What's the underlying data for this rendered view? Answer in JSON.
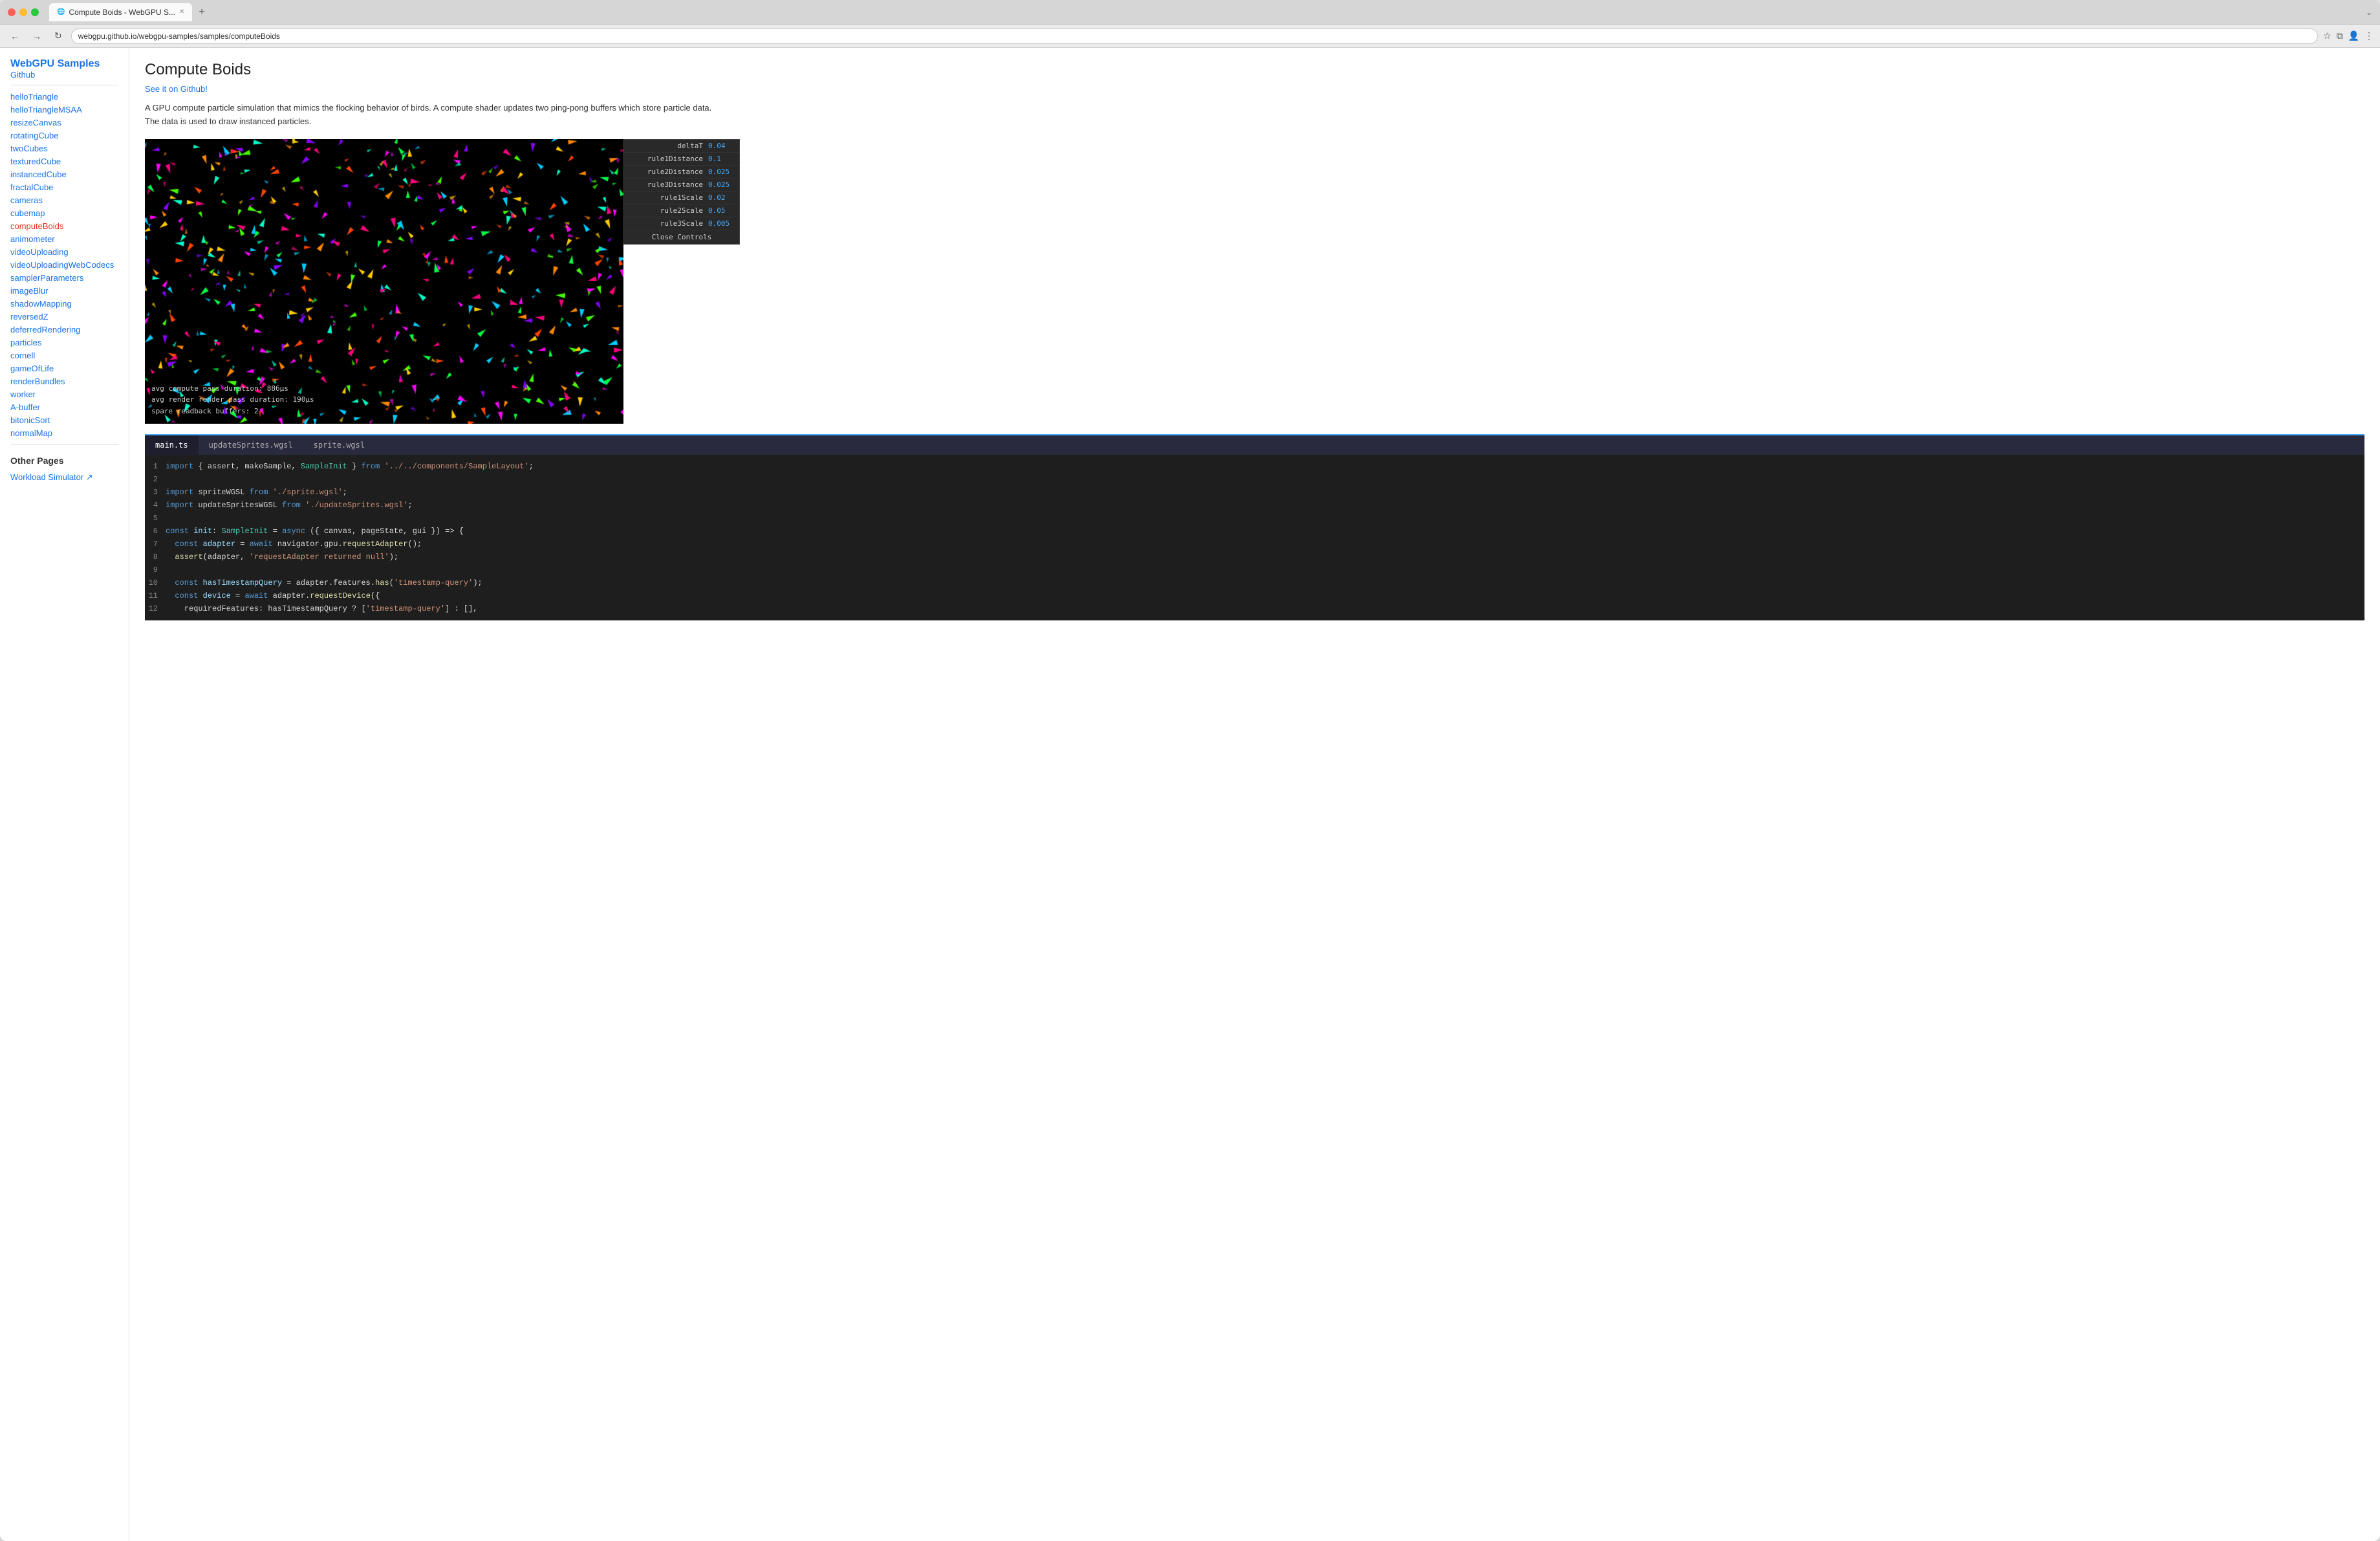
{
  "browser": {
    "tab_title": "Compute Boids - WebGPU S...",
    "url": "webgpu.github.io/webgpu-samples/samples/computeBoids",
    "new_tab_label": "+",
    "nav": {
      "back": "←",
      "forward": "→",
      "reload": "↻"
    }
  },
  "sidebar": {
    "title": "WebGPU Samples",
    "github_link": "Github",
    "nav_items": [
      {
        "label": "helloTriangle",
        "active": false
      },
      {
        "label": "helloTriangleMSAA",
        "active": false
      },
      {
        "label": "resizeCanvas",
        "active": false
      },
      {
        "label": "rotatingCube",
        "active": false
      },
      {
        "label": "twoCubes",
        "active": false
      },
      {
        "label": "texturedCube",
        "active": false
      },
      {
        "label": "instancedCube",
        "active": false
      },
      {
        "label": "fractalCube",
        "active": false
      },
      {
        "label": "cameras",
        "active": false
      },
      {
        "label": "cubemap",
        "active": false
      },
      {
        "label": "computeBoids",
        "active": true
      },
      {
        "label": "animometer",
        "active": false
      },
      {
        "label": "videoUploading",
        "active": false
      },
      {
        "label": "videoUploadingWebCodecs",
        "active": false
      },
      {
        "label": "samplerParameters",
        "active": false
      },
      {
        "label": "imageBlur",
        "active": false
      },
      {
        "label": "shadowMapping",
        "active": false
      },
      {
        "label": "reversedZ",
        "active": false
      },
      {
        "label": "deferredRendering",
        "active": false
      },
      {
        "label": "particles",
        "active": false
      },
      {
        "label": "cornell",
        "active": false
      },
      {
        "label": "gameOfLife",
        "active": false
      },
      {
        "label": "renderBundles",
        "active": false
      },
      {
        "label": "worker",
        "active": false
      },
      {
        "label": "A-buffer",
        "active": false
      },
      {
        "label": "bitonicSort",
        "active": false
      },
      {
        "label": "normalMap",
        "active": false
      }
    ],
    "other_pages_title": "Other Pages",
    "other_pages": [
      {
        "label": "Workload Simulator ↗"
      }
    ]
  },
  "main": {
    "title": "Compute Boids",
    "github_link": "See it on Github!",
    "description": "A GPU compute particle simulation that mimics the flocking behavior of birds. A compute shader updates two ping-pong buffers which store particle data. The data is used to draw instanced particles.",
    "stats": {
      "compute_pass": "avg compute pass duration:  886µs",
      "render_pass": "avg render render pass duration:  190µs",
      "spare_readback": "spare readback buffers:    2"
    },
    "controls": {
      "items": [
        {
          "label": "deltaT",
          "value": "0.04"
        },
        {
          "label": "rule1Distance",
          "value": "0.1"
        },
        {
          "label": "rule2Distance",
          "value": "0.025"
        },
        {
          "label": "rule3Distance",
          "value": "0.025"
        },
        {
          "label": "rule1Scale",
          "value": "0.02"
        },
        {
          "label": "rule2Scale",
          "value": "0.05"
        },
        {
          "label": "rule3Scale",
          "value": "0.005"
        }
      ],
      "close_label": "Close Controls"
    },
    "tabs": [
      {
        "label": "main.ts",
        "active": true
      },
      {
        "label": "updateSprites.wgsl",
        "active": false
      },
      {
        "label": "sprite.wgsl",
        "active": false
      }
    ],
    "code_lines": [
      {
        "num": 1,
        "content": "import { assert, makeSample, SampleInit } from '../../components/SampleLayout';"
      },
      {
        "num": 2,
        "content": ""
      },
      {
        "num": 3,
        "content": "import spriteWGSL from './sprite.wgsl';"
      },
      {
        "num": 4,
        "content": "import updateSpritesWGSL from './updateSprites.wgsl';"
      },
      {
        "num": 5,
        "content": ""
      },
      {
        "num": 6,
        "content": "const init: SampleInit = async ({ canvas, pageState, gui }) => {"
      },
      {
        "num": 7,
        "content": "  const adapter = await navigator.gpu.requestAdapter();"
      },
      {
        "num": 8,
        "content": "  assert(adapter, 'requestAdapter returned null');"
      },
      {
        "num": 9,
        "content": ""
      },
      {
        "num": 10,
        "content": "  const hasTimestampQuery = adapter.features.has('timestamp-query');"
      },
      {
        "num": 11,
        "content": "  const device = await adapter.requestDevice({"
      },
      {
        "num": 12,
        "content": "    requiredFeatures: hasTimestampQuery ? ['timestamp-query'] : [],"
      }
    ]
  }
}
